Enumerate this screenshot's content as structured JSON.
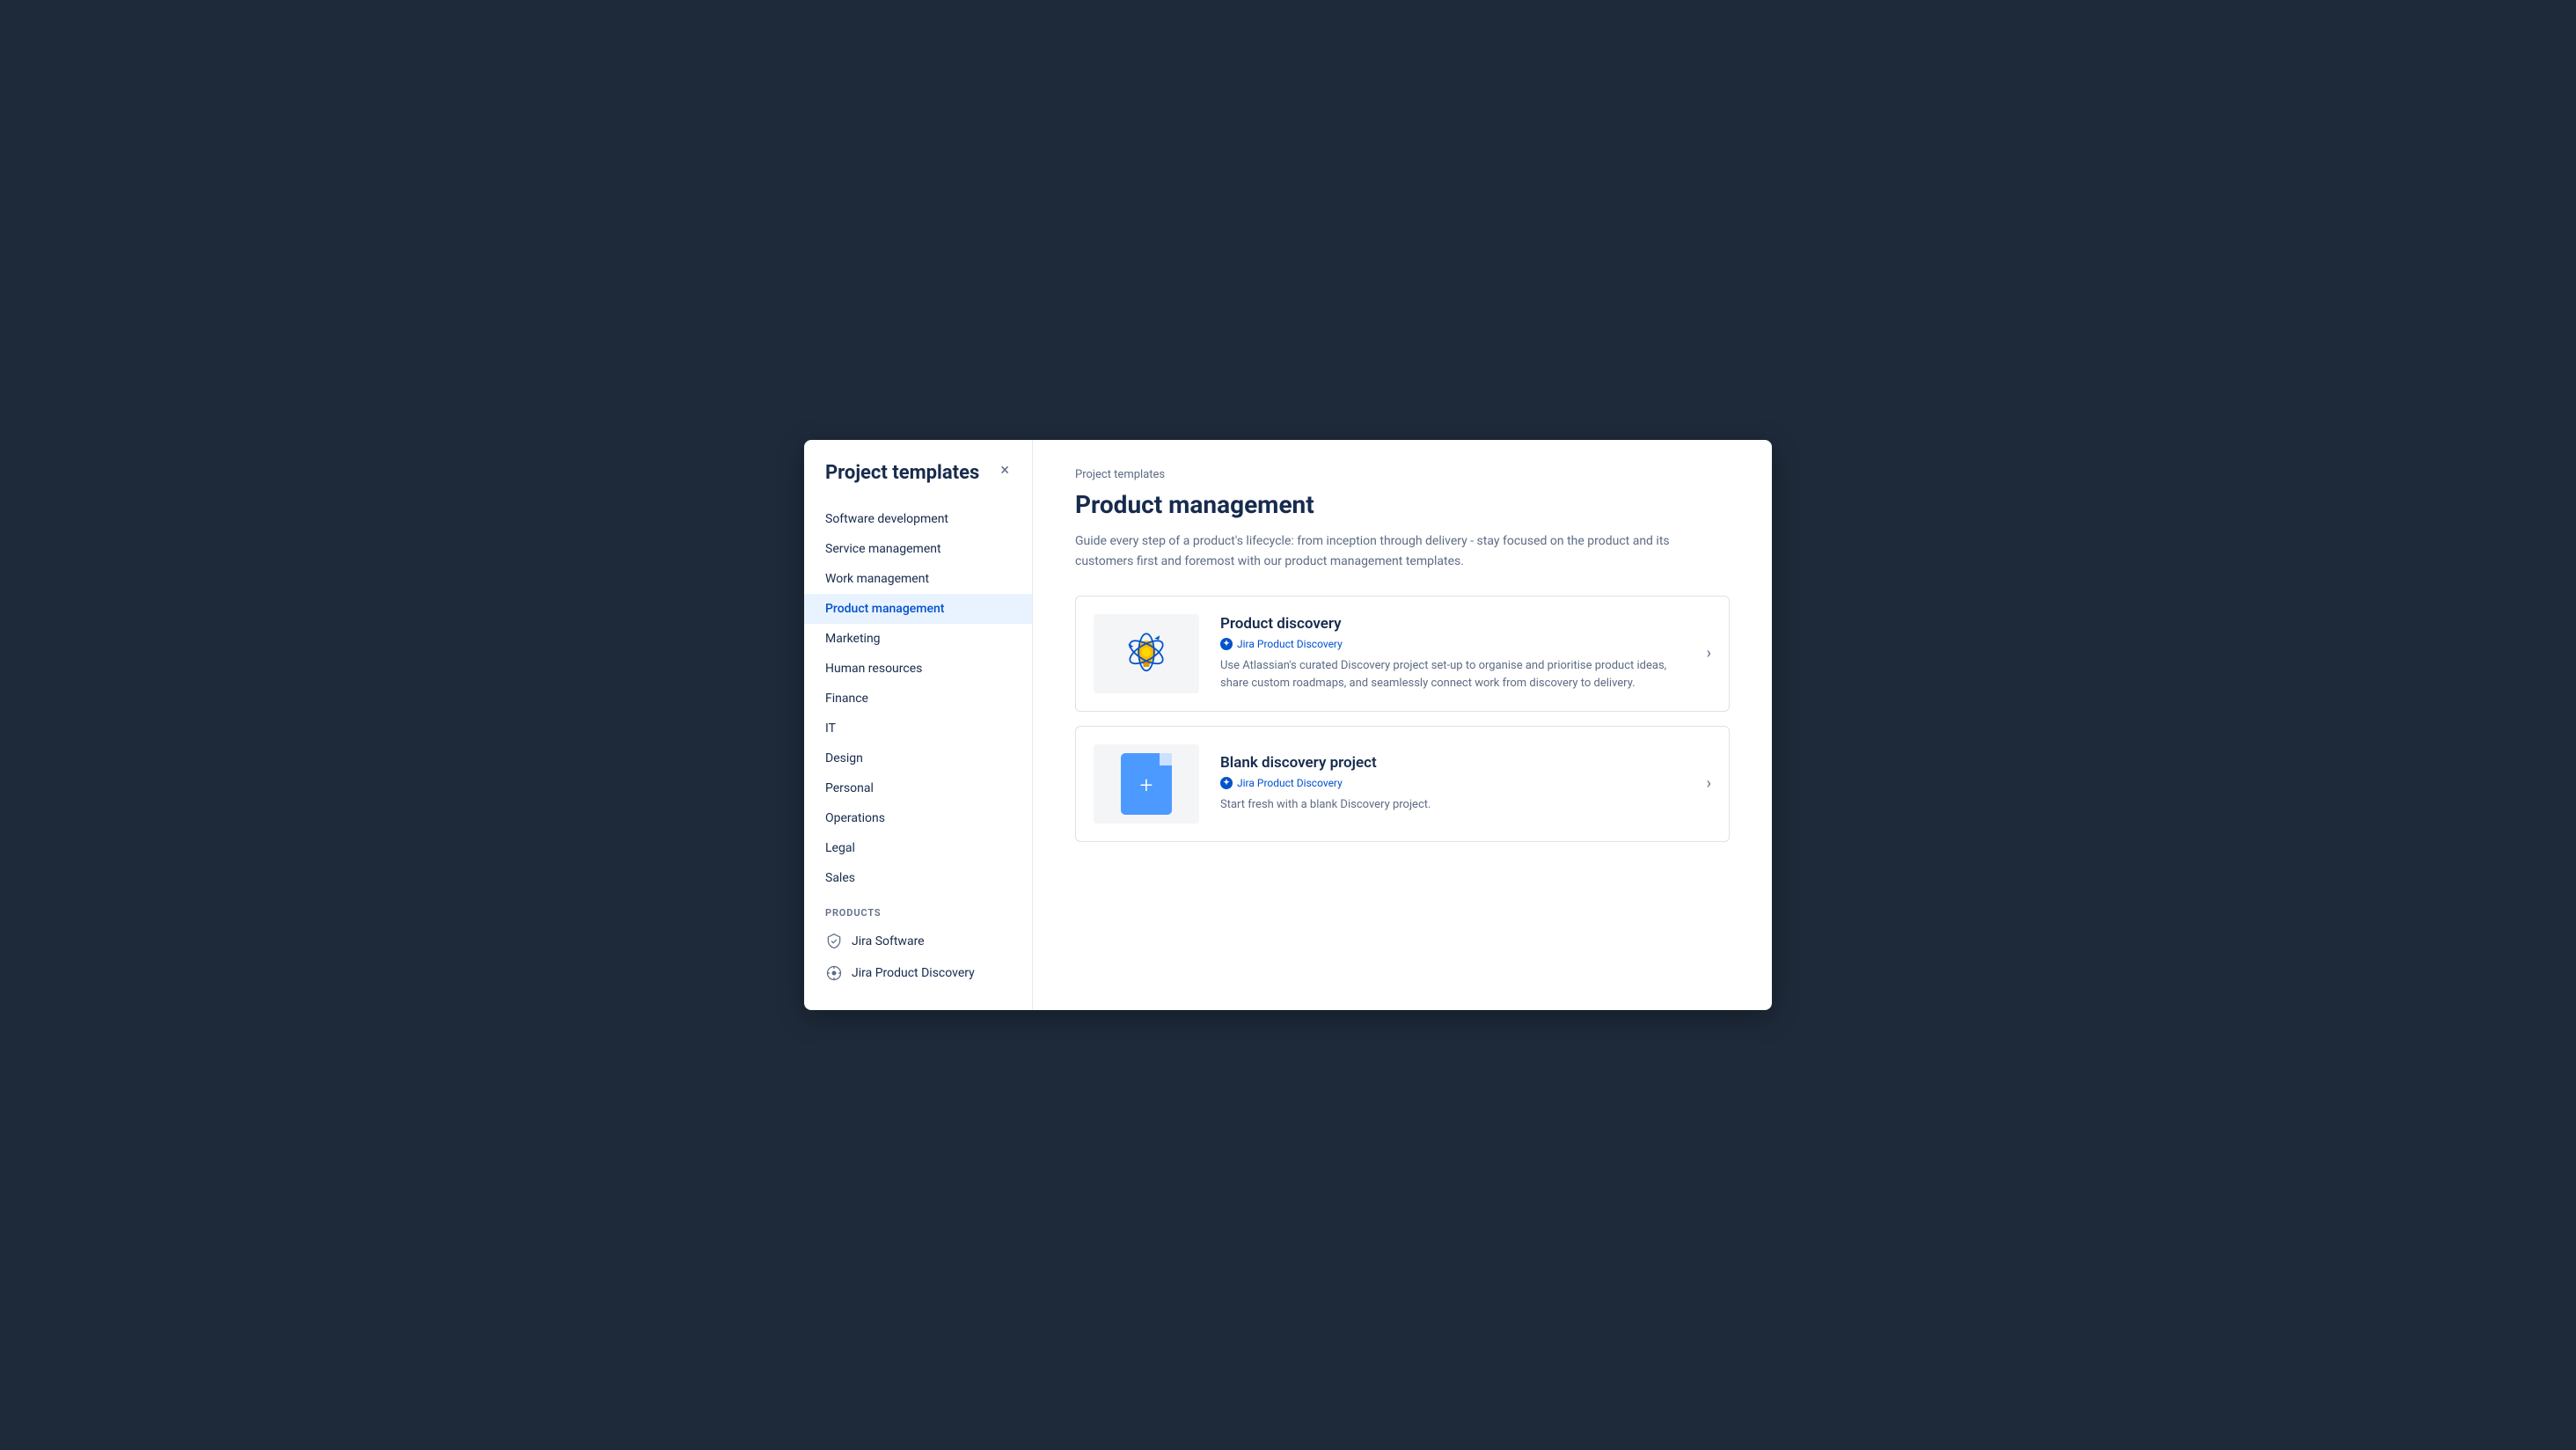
{
  "modal": {
    "close_label": "×"
  },
  "sidebar": {
    "title": "Project templates",
    "nav_items": [
      {
        "id": "software-development",
        "label": "Software development",
        "active": false
      },
      {
        "id": "service-management",
        "label": "Service management",
        "active": false
      },
      {
        "id": "work-management",
        "label": "Work management",
        "active": false
      },
      {
        "id": "product-management",
        "label": "Product management",
        "active": true
      },
      {
        "id": "marketing",
        "label": "Marketing",
        "active": false
      },
      {
        "id": "human-resources",
        "label": "Human resources",
        "active": false
      },
      {
        "id": "finance",
        "label": "Finance",
        "active": false
      },
      {
        "id": "it",
        "label": "IT",
        "active": false
      },
      {
        "id": "design",
        "label": "Design",
        "active": false
      },
      {
        "id": "personal",
        "label": "Personal",
        "active": false
      },
      {
        "id": "operations",
        "label": "Operations",
        "active": false
      },
      {
        "id": "legal",
        "label": "Legal",
        "active": false
      },
      {
        "id": "sales",
        "label": "Sales",
        "active": false
      }
    ],
    "products_label": "PRODUCTS",
    "products": [
      {
        "id": "jira-software",
        "label": "Jira Software"
      },
      {
        "id": "jira-product-discovery",
        "label": "Jira Product Discovery"
      }
    ]
  },
  "main": {
    "breadcrumb": "Project templates",
    "title": "Product management",
    "description": "Guide every step of a product's lifecycle: from inception through delivery - stay focused on the product and its customers first and foremost with our product management templates.",
    "templates": [
      {
        "id": "product-discovery",
        "name": "Product discovery",
        "product": "Jira Product Discovery",
        "description": "Use Atlassian's curated Discovery project set-up to organise and prioritise product ideas, share custom roadmaps, and seamlessly connect work from discovery to delivery.",
        "icon_type": "discovery"
      },
      {
        "id": "blank-discovery",
        "name": "Blank discovery project",
        "product": "Jira Product Discovery",
        "description": "Start fresh with a blank Discovery project.",
        "icon_type": "blank"
      }
    ]
  }
}
